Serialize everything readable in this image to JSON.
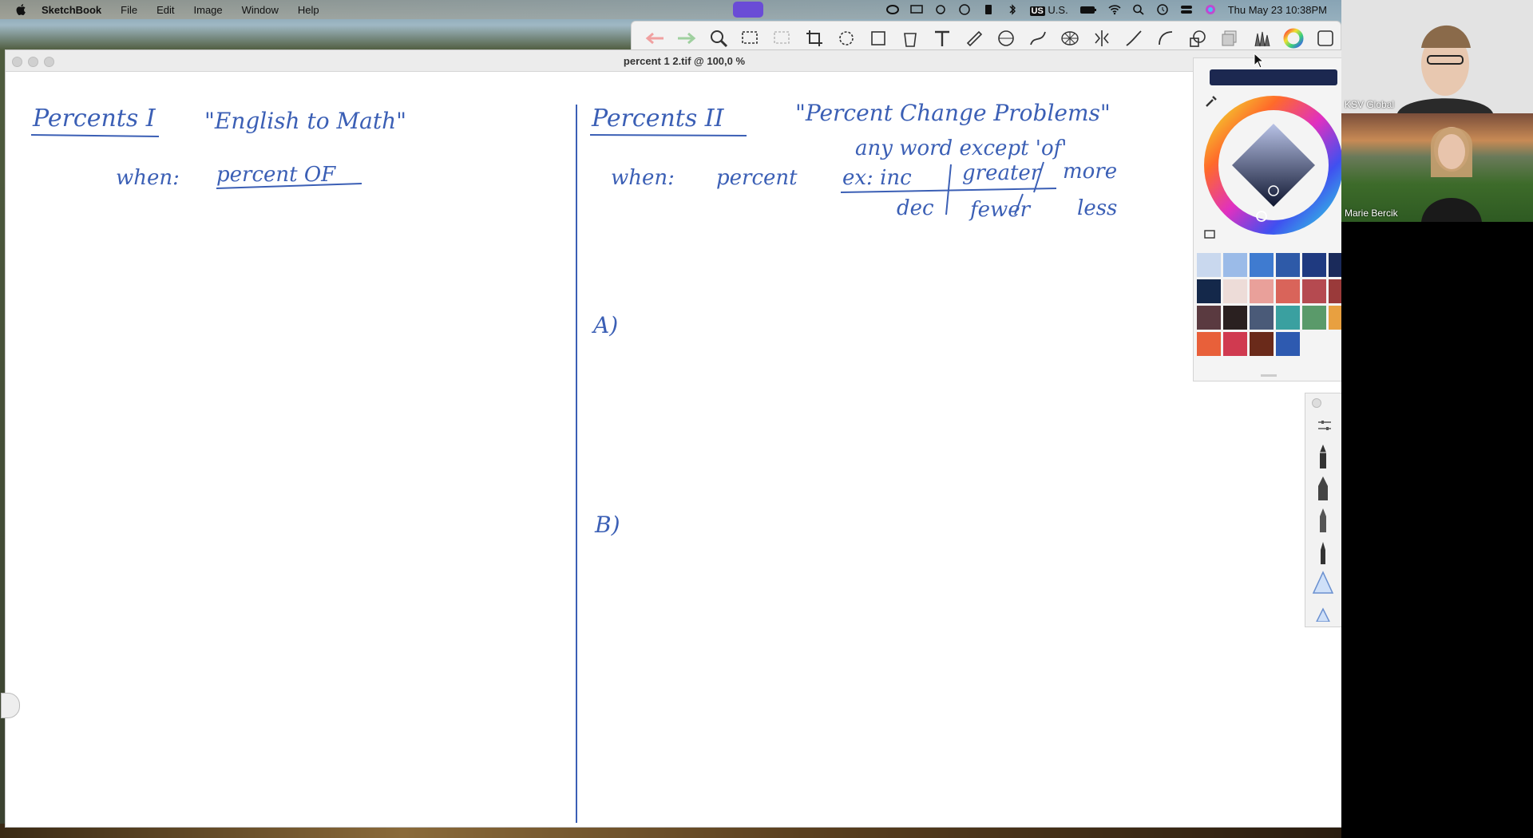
{
  "menubar": {
    "items": [
      "SketchBook",
      "File",
      "Edit",
      "Image",
      "Window",
      "Help"
    ],
    "status": {
      "keyboard": "US",
      "locale": "U.S.",
      "datetime": "Thu May 23  10:38PM"
    }
  },
  "window": {
    "title": "percent 1 2.tif @ 100,0 %"
  },
  "canvas": {
    "left_title": "Percents I",
    "left_quote": "\"English to Math\"",
    "left_when_label": "when:",
    "left_when_value": "percent OF",
    "right_title": "Percents II",
    "right_quote": "\"Percent Change Problems\"",
    "right_note": "any word except 'of'",
    "right_when_label": "when:",
    "right_when_value": "percent",
    "right_ex": "ex: inc",
    "right_greater": "greater",
    "right_more": "more",
    "right_dec": "dec",
    "right_fewer": "fewer",
    "right_less": "less",
    "label_a": "A)",
    "label_b": "B)"
  },
  "colors": {
    "ink": "#3b5fb5",
    "divider": "#3b5fb5",
    "current_color": "#1c2850",
    "swatches": [
      "#c9d8ee",
      "#9bbbe8",
      "#3f7bd0",
      "#2e5aa8",
      "#1f3a80",
      "#1a2a5a",
      "#14284a",
      "#eddcd8",
      "#e9a09a",
      "#d9645a",
      "#b54a50",
      "#9a3a3a",
      "#5a3a40",
      "#2a2020",
      "#4a5a78",
      "#3aa0a0",
      "#5a9a6a",
      "#e8a040",
      "#e8603a",
      "#d03a50",
      "#6a2a1a",
      "#2e5ab0"
    ]
  },
  "video": {
    "tile1_name": "KSV Global",
    "tile2_name": "Marie Bercik"
  }
}
